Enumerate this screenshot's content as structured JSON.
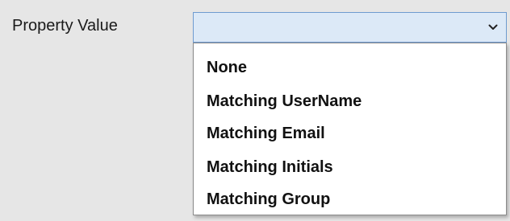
{
  "form": {
    "property_value_label": "Property Value",
    "combo_selected": ""
  },
  "dropdown": {
    "chevron_icon": "chevron-down-icon",
    "options": [
      {
        "label": "None"
      },
      {
        "label": "Matching UserName"
      },
      {
        "label": "Matching Email"
      },
      {
        "label": "Matching Initials"
      },
      {
        "label": "Matching Group"
      }
    ]
  },
  "colors": {
    "background": "#e6e6e6",
    "combo_fill": "#dce9f7",
    "combo_border": "#6e9bd0",
    "list_background": "#ffffff"
  }
}
